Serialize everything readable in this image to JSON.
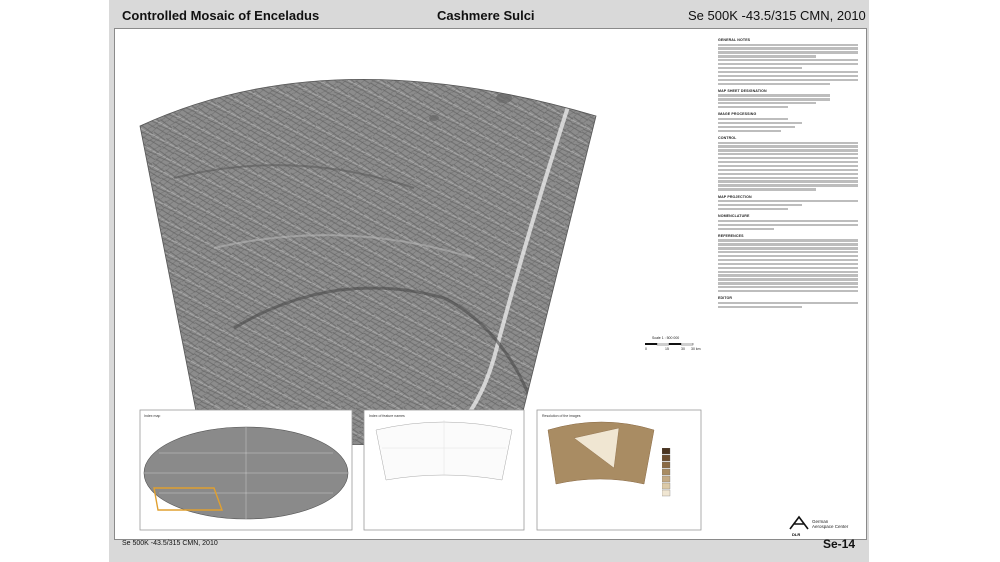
{
  "header": {
    "left_title": "Controlled Mosaic of Enceladus",
    "center_title": "Cashmere Sulci",
    "right_title": "Se 500K -43.5/315 CMN, 2010"
  },
  "footer": {
    "left": "Se 500K -43.5/315 CMN, 2010",
    "right": "Se-14"
  },
  "scale": {
    "label": "Scale 1 : 500 000",
    "ticks": [
      "0",
      "15",
      "30",
      "30 km"
    ]
  },
  "insets": {
    "index_title": "Index map",
    "names_title": "Index of feature names",
    "resolution_title": "Resolution of the images"
  },
  "text_column": {
    "headings": [
      "GENERAL NOTES",
      "MAP SHEET DESIGNATION",
      "IMAGE PROCESSING",
      "CONTROL",
      "MAP PROJECTION",
      "NOMENCLATURE",
      "REFERENCES",
      "EDITOR"
    ]
  },
  "publisher": {
    "name_line1": "German",
    "name_line2": "Aerospace Center",
    "logo_text": "DLR"
  },
  "colors": {
    "sheet_bg": "#d9d9d9",
    "frame_bg": "#ffffff",
    "mosaic_tone": "#8a8a8a",
    "index_highlight": "#e0a030",
    "resolution_legend": [
      "#4a3420",
      "#6b4d2f",
      "#8a6a45",
      "#a98c63",
      "#c4ab85",
      "#dccaa8",
      "#f0e6d2"
    ]
  }
}
